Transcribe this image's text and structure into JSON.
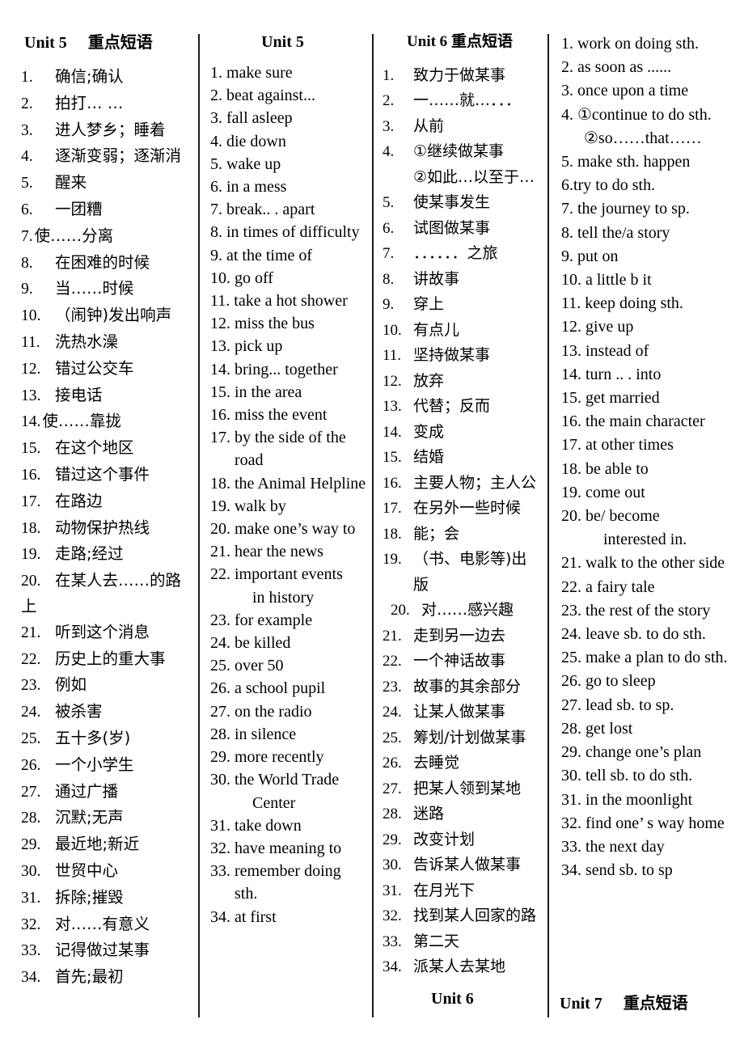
{
  "columns": [
    {
      "id": "col-unit5-cn",
      "header": {
        "unit": "Unit 5",
        "subtitle": "重点短语"
      },
      "items": [
        {
          "num": "1.",
          "text": "确信;确认"
        },
        {
          "num": "2.",
          "text": "拍打… …"
        },
        {
          "num": "3.",
          "text": "进人梦乡；睡着"
        },
        {
          "num": "4.",
          "text": "逐渐变弱；逐渐消"
        },
        {
          "num": "5.",
          "text": "醒来"
        },
        {
          "num": "6.",
          "text": "一团糟"
        },
        {
          "num": "7.",
          "text": "使……分离",
          "tight": true
        },
        {
          "num": "8.",
          "text": "在困难的时候"
        },
        {
          "num": "9.",
          "text": "当……时候"
        },
        {
          "num": "10.",
          "text": "（闹钟)发出响声"
        },
        {
          "num": "11.",
          "text": "洗热水澡"
        },
        {
          "num": "12.",
          "text": "错过公交车"
        },
        {
          "num": "13.",
          "text": "接电话"
        },
        {
          "num": "14.",
          "text": "使……靠拢",
          "tight": true
        },
        {
          "num": "15.",
          "text": "在这个地区"
        },
        {
          "num": "16.",
          "text": "错过这个事件"
        },
        {
          "num": "17.",
          "text": "在路边"
        },
        {
          "num": "18.",
          "text": "动物保护热线"
        },
        {
          "num": "19.",
          "text": "走路;经过"
        },
        {
          "num": "20.",
          "text": "在某人去……的路",
          "wrap": "上"
        },
        {
          "num": "21.",
          "text": "听到这个消息"
        },
        {
          "num": "22.",
          "text": "历史上的重大事"
        },
        {
          "num": "23.",
          "text": "例如"
        },
        {
          "num": "24.",
          "text": "被杀害"
        },
        {
          "num": "25.",
          "text": "五十多(岁)"
        },
        {
          "num": "26.",
          "text": "一个小学生"
        },
        {
          "num": "27.",
          "text": "通过广播"
        },
        {
          "num": "28.",
          "text": "沉默;无声"
        },
        {
          "num": "29.",
          "text": "最近地;新近"
        },
        {
          "num": "30.",
          "text": "世贸中心"
        },
        {
          "num": "31.",
          "text": "拆除;摧毁"
        },
        {
          "num": "32.",
          "text": "对……有意义"
        },
        {
          "num": "33.",
          "text": "记得做过某事"
        },
        {
          "num": "34.",
          "text": "首先;最初"
        }
      ]
    },
    {
      "id": "col-unit5-en",
      "header": {
        "unit": "Unit 5",
        "subtitle": ""
      },
      "items": [
        {
          "num": "1.",
          "text": "make sure"
        },
        {
          "num": "2.",
          "text": "beat against..."
        },
        {
          "num": "3.",
          "text": "fall asleep"
        },
        {
          "num": "4.",
          "text": "die down"
        },
        {
          "num": "5.",
          "text": "wake up"
        },
        {
          "num": "6.",
          "text": "in a mess"
        },
        {
          "num": "7.",
          "text": "break.. . apart"
        },
        {
          "num": "8.",
          "text": "in times of difficulty"
        },
        {
          "num": "9.",
          "text": "at the time of"
        },
        {
          "num": "10.",
          "text": "go off"
        },
        {
          "num": "11.",
          "text": "take a hot shower"
        },
        {
          "num": "12.",
          "text": "miss the bus"
        },
        {
          "num": "13.",
          "text": "pick up"
        },
        {
          "num": "14.",
          "text": "bring... together"
        },
        {
          "num": "15.",
          "text": "in the area"
        },
        {
          "num": "16.",
          "text": "miss the event"
        },
        {
          "num": "17.",
          "text": "by the side of the road"
        },
        {
          "num": "18.",
          "text": "the Animal Helpline"
        },
        {
          "num": "19.",
          "text": "walk by"
        },
        {
          "num": "20.",
          "text": "make one’s way to"
        },
        {
          "num": "21.",
          "text": "hear the news"
        },
        {
          "num": "22.",
          "text": "important events",
          "sub": "in history"
        },
        {
          "num": "23.",
          "text": "for example"
        },
        {
          "num": "24.",
          "text": "be killed"
        },
        {
          "num": "25.",
          "text": "over 50"
        },
        {
          "num": "26.",
          "text": "a school pupil"
        },
        {
          "num": "27.",
          "text": "on the radio"
        },
        {
          "num": "28.",
          "text": "in silence"
        },
        {
          "num": "29.",
          "text": "more recently"
        },
        {
          "num": "30.",
          "text": "the World Trade",
          "sub": "Center"
        },
        {
          "num": "31.",
          "text": "take down"
        },
        {
          "num": "32.",
          "text": "have meaning to"
        },
        {
          "num": "33.",
          "text": "remember doing sth."
        },
        {
          "num": "34.",
          "text": "at first"
        }
      ]
    },
    {
      "id": "col-unit6-cn",
      "header": {
        "unit": "Unit 6",
        "subtitle": "重点短语"
      },
      "items": [
        {
          "num": "1.",
          "text": "致力于做某事"
        },
        {
          "num": "2.",
          "text": "一……就…．．．"
        },
        {
          "num": "3.",
          "text": "从前"
        },
        {
          "num": "4.",
          "text": "①继续做某事",
          "sub": "②如此…以至于…"
        },
        {
          "num": "5.",
          "text": "使某事发生"
        },
        {
          "num": "6.",
          "text": "试图做某事"
        },
        {
          "num": "7.",
          "text": "．．．．．．之旅"
        },
        {
          "num": "8.",
          "text": "讲故事"
        },
        {
          "num": "9.",
          "text": "穿上"
        },
        {
          "num": "10.",
          "text": "有点儿"
        },
        {
          "num": "11.",
          "text": "坚持做某事"
        },
        {
          "num": "12.",
          "text": "放弃"
        },
        {
          "num": "13.",
          "text": "代替；反而"
        },
        {
          "num": "14.",
          "text": "变成"
        },
        {
          "num": "15.",
          "text": "结婚"
        },
        {
          "num": "16.",
          "text": "主要人物；主人公"
        },
        {
          "num": "17.",
          "text": "在另外一些时候"
        },
        {
          "num": "18.",
          "text": "能；会"
        },
        {
          "num": "19.",
          "text": "（书、电影等)出版"
        },
        {
          "num": "20.",
          "text": "对……感兴趣",
          "indent": true
        },
        {
          "num": "21.",
          "text": "走到另一边去"
        },
        {
          "num": "22.",
          "text": "一个神话故事"
        },
        {
          "num": "23.",
          "text": "故事的其余部分"
        },
        {
          "num": "24.",
          "text": "让某人做某事"
        },
        {
          "num": "25.",
          "text": "筹划/计划做某事"
        },
        {
          "num": "26.",
          "text": "去睡觉"
        },
        {
          "num": "27.",
          "text": "把某人领到某地"
        },
        {
          "num": "28.",
          "text": "迷路"
        },
        {
          "num": "29.",
          "text": "改变计划"
        },
        {
          "num": "30.",
          "text": "告诉某人做某事"
        },
        {
          "num": "31.",
          "text": "在月光下"
        },
        {
          "num": "32.",
          "text": "找到某人回家的路"
        },
        {
          "num": "33.",
          "text": "第二天"
        },
        {
          "num": "34.",
          "text": "派某人去某地"
        }
      ],
      "footer": "Unit 6"
    },
    {
      "id": "col-unit6-en",
      "header": null,
      "items": [
        {
          "num": "1.",
          "text": "work on doing sth."
        },
        {
          "num": "2.",
          "text": "as soon as ......"
        },
        {
          "num": "3.",
          "text": "once upon a time"
        },
        {
          "num": "4.",
          "text": "①continue to do sth.",
          "sub": "②so……that……",
          "gap": true
        },
        {
          "num": "5.",
          "text": "make sth. happen"
        },
        {
          "num": "6.",
          "text": "try to do sth.",
          "nogap": true
        },
        {
          "num": "7.",
          "text": "the journey to sp."
        },
        {
          "num": "8.",
          "text": "tell the/a story"
        },
        {
          "num": "9.",
          "text": "put on"
        },
        {
          "num": "10.",
          "text": "a little b it"
        },
        {
          "num": "11.",
          "text": "keep doing sth."
        },
        {
          "num": "12.",
          "text": "give up"
        },
        {
          "num": "13.",
          "text": "instead of"
        },
        {
          "num": "14.",
          "text": "turn .. . into"
        },
        {
          "num": "15.",
          "text": "get married"
        },
        {
          "num": "16.",
          "text": "the main character"
        },
        {
          "num": "17.",
          "text": "at other times"
        },
        {
          "num": "18.",
          "text": "be able to"
        },
        {
          "num": "19.",
          "text": "come out"
        },
        {
          "num": "20.",
          "text": "be/ become",
          "sub": "interested in."
        },
        {
          "num": "21.",
          "text": "walk to the other side",
          "small": true
        },
        {
          "num": "22.",
          "text": "a fairy tale"
        },
        {
          "num": "23.",
          "text": "the rest of the story"
        },
        {
          "num": "24.",
          "text": "leave sb. to do sth."
        },
        {
          "num": "25.",
          "text": "make a plan to do sth.",
          "small": true
        },
        {
          "num": "26.",
          "text": "go to sleep"
        },
        {
          "num": "27.",
          "text": "lead sb. to sp."
        },
        {
          "num": "28.",
          "text": "get lost"
        },
        {
          "num": "29.",
          "text": "change one’s plan"
        },
        {
          "num": "30.",
          "text": "tell sb. to do sth."
        },
        {
          "num": "31.",
          "text": "in the moonlight"
        },
        {
          "num": "32.",
          "text": "find one’ s way home"
        },
        {
          "num": "33.",
          "text": "the next day"
        },
        {
          "num": "34.",
          "text": "send sb. to sp"
        }
      ],
      "footer": {
        "unit": "Unit 7",
        "subtitle": "重点短语"
      }
    }
  ],
  "footers": {
    "unit6": "Unit 6",
    "unit7_unit": "Unit 7",
    "unit7_subtitle": "重点短语"
  },
  "colors": {
    "text": "#000000",
    "rule": "#1a1a1a",
    "background": "#ffffff"
  }
}
